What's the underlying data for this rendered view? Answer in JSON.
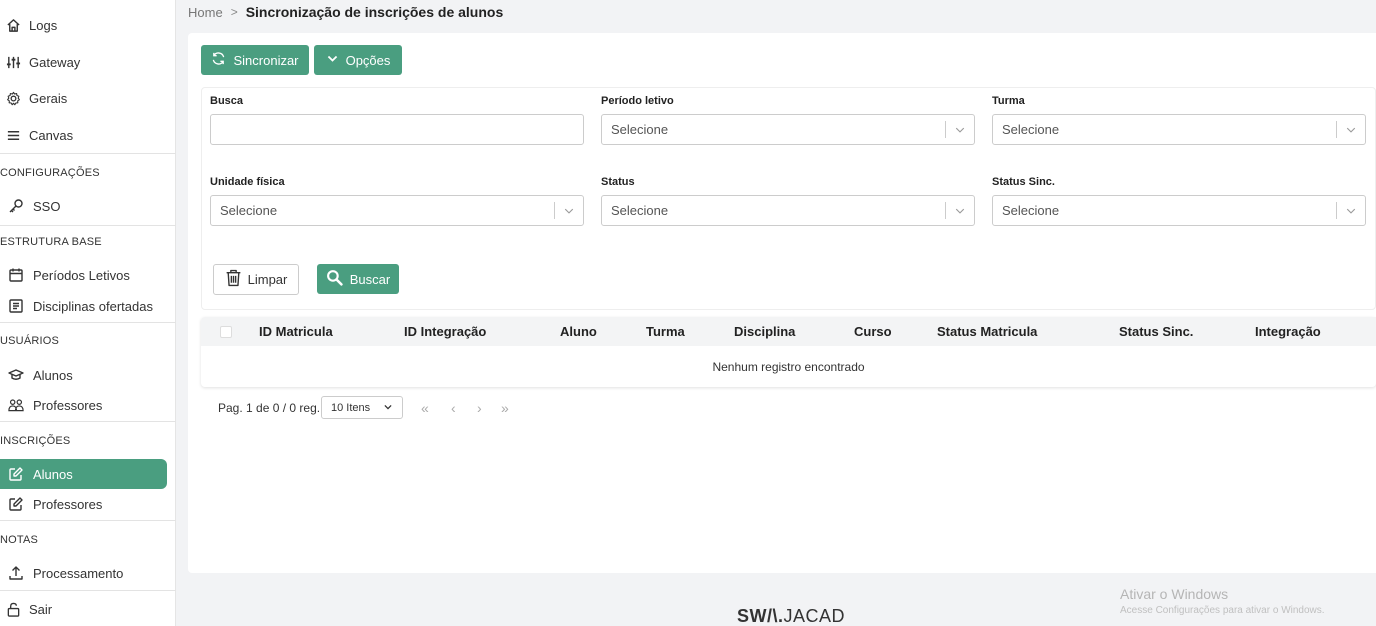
{
  "sidebar": {
    "top_items": [
      {
        "label": "Logs",
        "icon": "home-icon"
      },
      {
        "label": "Gateway",
        "icon": "sliders-icon"
      },
      {
        "label": "Gerais",
        "icon": "gear-icon"
      },
      {
        "label": "Canvas",
        "icon": "menu-icon"
      }
    ],
    "sections": {
      "configuracoes": "CONFIGURAÇÕES",
      "estrutura": "ESTRUTURA BASE",
      "usuarios": "USUÁRIOS",
      "inscricoes": "INSCRIÇÕES",
      "notas": "NOTAS"
    },
    "sso": "SSO",
    "periodos": "Períodos Letivos",
    "disciplinas": "Disciplinas ofertadas",
    "alunos_users": "Alunos",
    "professores_users": "Professores",
    "alunos_insc": "Alunos",
    "professores_insc": "Professores",
    "processamento": "Processamento",
    "sair": "Sair"
  },
  "breadcrumb": {
    "home": "Home",
    "current": "Sincronização de inscrições de alunos"
  },
  "toolbar": {
    "sync_label": "Sincronizar",
    "options_label": "Opções"
  },
  "filters": {
    "busca": {
      "label": "Busca",
      "value": ""
    },
    "periodo": {
      "label": "Período letivo",
      "placeholder": "Selecione"
    },
    "turma": {
      "label": "Turma",
      "placeholder": "Selecione"
    },
    "unidade": {
      "label": "Unidade física",
      "placeholder": "Selecione"
    },
    "status": {
      "label": "Status",
      "placeholder": "Selecione"
    },
    "status_sinc": {
      "label": "Status Sinc.",
      "placeholder": "Selecione"
    },
    "clear_label": "Limpar",
    "search_label": "Buscar"
  },
  "table": {
    "columns": [
      "ID Matricula",
      "ID Integração",
      "Aluno",
      "Turma",
      "Disciplina",
      "Curso",
      "Status Matricula",
      "Status Sinc.",
      "Integração"
    ],
    "empty_text": "Nenhum registro encontrado"
  },
  "pagination": {
    "info": "Pag. 1 de 0 / 0 reg.",
    "per_page": "10 Itens"
  },
  "footer": {
    "logo_part1": "SW",
    "logo_part2": "/\\.",
    "logo_part3": "JACAD",
    "windows_title": "Ativar o Windows",
    "windows_sub": "Acesse Configurações para ativar o Windows."
  },
  "colors": {
    "accent": "#4a9e80"
  }
}
